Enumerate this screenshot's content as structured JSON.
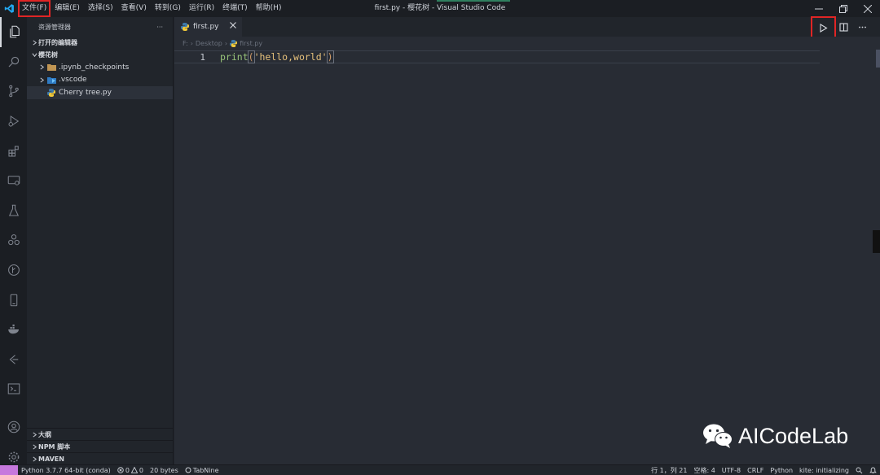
{
  "window": {
    "title": "first.py - 樱花树 - Visual Studio Code"
  },
  "menu": [
    {
      "label": "文件(F)"
    },
    {
      "label": "编辑(E)"
    },
    {
      "label": "选择(S)"
    },
    {
      "label": "查看(V)"
    },
    {
      "label": "转到(G)"
    },
    {
      "label": "运行(R)"
    },
    {
      "label": "终端(T)"
    },
    {
      "label": "帮助(H)"
    }
  ],
  "sidebar": {
    "header": "资源管理器",
    "more": "···",
    "open_editors": "打开的编辑器",
    "workspace": "樱花树",
    "items": [
      {
        "label": ".ipynb_checkpoints"
      },
      {
        "label": ".vscode"
      },
      {
        "label": "Cherry tree.py"
      }
    ],
    "bottom": [
      {
        "label": "大纲"
      },
      {
        "label": "NPM 脚本"
      },
      {
        "label": "MAVEN"
      }
    ]
  },
  "editor": {
    "tab": "first.py",
    "breadcrumb": [
      "F:",
      "Desktop",
      "first.py"
    ],
    "line_number": "1",
    "code": {
      "fn": "print",
      "open": "(",
      "str": "'hello,world'",
      "close": ")"
    }
  },
  "watermark": "AICodeLab",
  "status": {
    "interpreter": "Python 3.7.7 64-bit (conda)",
    "errors": "0",
    "warnings": "0",
    "size": "20 bytes",
    "tabnine": "TabNine",
    "position": "行 1，列 21",
    "spaces": "空格: 4",
    "encoding": "UTF-8",
    "eol": "CRLF",
    "language": "Python",
    "kite": "kite: initializing"
  },
  "colors": {
    "accent_highlight": "#e02525",
    "remote": "#c678dd",
    "vscode_blue": "#23a9f2"
  }
}
